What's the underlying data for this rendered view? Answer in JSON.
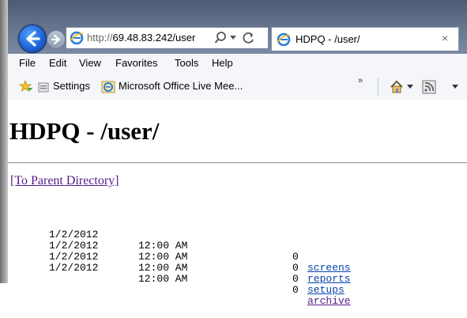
{
  "browser": {
    "address": {
      "url_prefix": "http://",
      "url_host": "69.48.83.242/user",
      "search_label": "⌕",
      "dropdown_label": "▾",
      "refresh_label": "↻"
    },
    "tab": {
      "title": "HDPQ - /user/",
      "close_label": "×"
    },
    "menu": [
      "File",
      "Edit",
      "View",
      "Favorites",
      "Tools",
      "Help"
    ],
    "favorites": {
      "items": [
        {
          "label": "Settings"
        },
        {
          "label": "Microsoft Office Live Mee..."
        }
      ],
      "more_label": "»"
    },
    "toolbar": {
      "dropdown_label": "▾"
    }
  },
  "page": {
    "title": "HDPQ - /user/",
    "parent_link": "[To Parent Directory]",
    "entries": [
      {
        "date": "1/2/2012",
        "time": "12:00 AM",
        "size": "0",
        "name": "screens",
        "visited": false
      },
      {
        "date": "1/2/2012",
        "time": "12:00 AM",
        "size": "0",
        "name": "reports",
        "visited": false
      },
      {
        "date": "1/2/2012",
        "time": "12:00 AM",
        "size": "0",
        "name": "setups",
        "visited": false
      },
      {
        "date": "1/2/2012",
        "time": "12:00 AM",
        "size": "0",
        "name": "archive",
        "visited": true
      }
    ]
  },
  "colors": {
    "link": "#0645ad",
    "visited_link": "#551a8b",
    "title_bar": "#6a7a93"
  }
}
